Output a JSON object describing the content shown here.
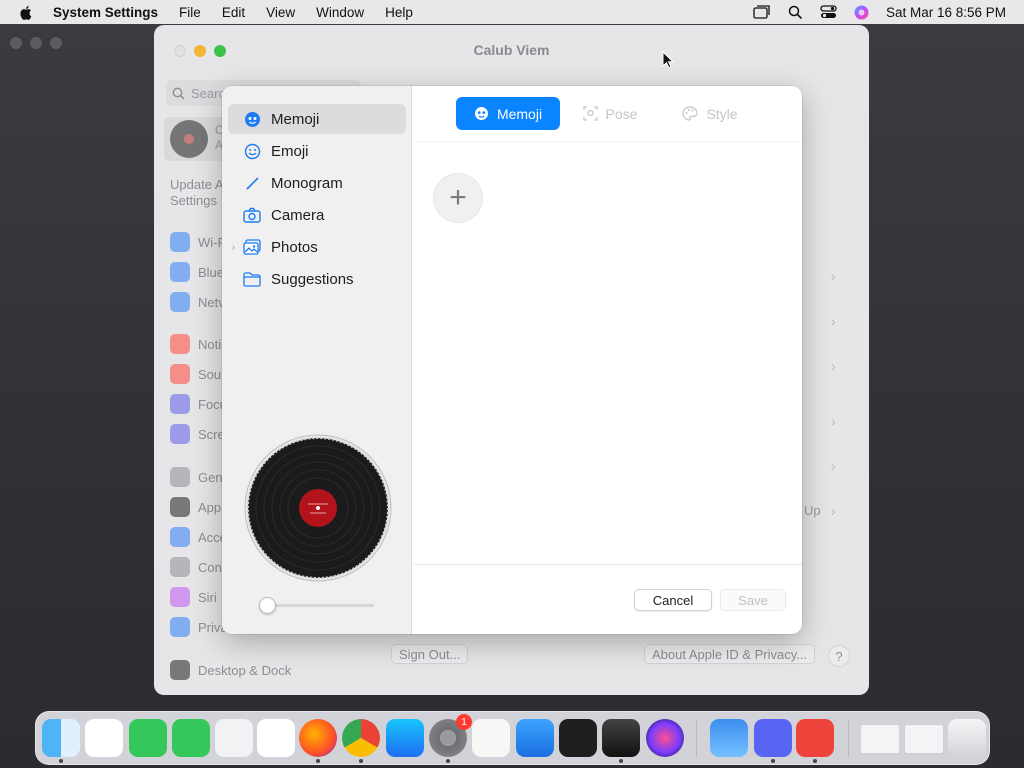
{
  "menubar": {
    "app_name": "System Settings",
    "menus": [
      "File",
      "Edit",
      "View",
      "Window",
      "Help"
    ],
    "clock": "Sat Mar 16  8:56 PM"
  },
  "settings_window": {
    "title": "Calub Viem",
    "search_placeholder": "Search",
    "profile_lines": [
      "C",
      "A"
    ],
    "update_lines": [
      "Update A",
      "Settings"
    ],
    "sidebar": [
      {
        "label": "Wi-F",
        "icon": "wifi-icon",
        "color": "#2f7ff7"
      },
      {
        "label": "Blue",
        "icon": "bluetooth-icon",
        "color": "#2f7ff7"
      },
      {
        "label": "Netv",
        "icon": "network-icon",
        "color": "#2f7ff7"
      },
      {
        "label": "Noti",
        "icon": "notifications-icon",
        "color": "#ff453a"
      },
      {
        "label": "Sour",
        "icon": "sound-icon",
        "color": "#ff453a"
      },
      {
        "label": "Focu",
        "icon": "focus-icon",
        "color": "#5e5ce6"
      },
      {
        "label": "Scre",
        "icon": "screen-time-icon",
        "color": "#5e5ce6"
      },
      {
        "label": "Gen",
        "icon": "general-icon",
        "color": "#8e8e93"
      },
      {
        "label": "App",
        "icon": "appearance-icon",
        "color": "#1d1d1f"
      },
      {
        "label": "Acce",
        "icon": "accessibility-icon",
        "color": "#2f7ff7"
      },
      {
        "label": "Con",
        "icon": "control-center-icon",
        "color": "#8e8e93"
      },
      {
        "label": "Siri",
        "icon": "siri-icon",
        "color": "#bf5af2"
      },
      {
        "label": "Priva",
        "icon": "privacy-icon",
        "color": "#2f7ff7"
      },
      {
        "label": "Desktop & Dock",
        "icon": "desktop-dock-icon",
        "color": "#1d1d1f"
      }
    ],
    "up_text": "Up",
    "sign_out": "Sign Out...",
    "about": "About Apple ID & Privacy...",
    "help": "?"
  },
  "picker": {
    "sources": [
      {
        "label": "Memoji",
        "icon": "memoji-icon",
        "selected": true
      },
      {
        "label": "Emoji",
        "icon": "emoji-icon"
      },
      {
        "label": "Monogram",
        "icon": "monogram-icon"
      },
      {
        "label": "Camera",
        "icon": "camera-icon"
      },
      {
        "label": "Photos",
        "icon": "photos-icon",
        "disclosure": true
      },
      {
        "label": "Suggestions",
        "icon": "folder-icon"
      }
    ],
    "tabs": [
      {
        "label": "Memoji",
        "state": "active"
      },
      {
        "label": "Pose",
        "state": "disabled"
      },
      {
        "label": "Style",
        "state": "disabled"
      }
    ],
    "add_label": "+",
    "zoom_level": 0,
    "cancel": "Cancel",
    "save": "Save",
    "accent": "#0a84ff"
  },
  "dock": {
    "apps": [
      {
        "name": "finder-icon",
        "running": true
      },
      {
        "name": "vscode-icon",
        "running": false
      },
      {
        "name": "facetime-icon",
        "running": false
      },
      {
        "name": "messages-icon",
        "running": false
      },
      {
        "name": "launchpad-icon",
        "running": false
      },
      {
        "name": "safari-icon",
        "running": false
      },
      {
        "name": "firefox-icon",
        "running": true
      },
      {
        "name": "chrome-icon",
        "running": true
      },
      {
        "name": "app-store-icon",
        "running": false
      },
      {
        "name": "system-settings-icon",
        "running": true,
        "badge": "1"
      },
      {
        "name": "textedit-icon",
        "running": false
      },
      {
        "name": "keynote-icon",
        "running": false
      },
      {
        "name": "terminal-icon",
        "running": false
      },
      {
        "name": "garageband-icon",
        "running": true
      },
      {
        "name": "siri-icon",
        "running": false
      },
      {
        "name": "weather-icon",
        "running": false
      },
      {
        "name": "discord-icon",
        "running": true
      },
      {
        "name": "anydesk-icon",
        "running": true
      },
      {
        "name": "window-thumbnail-1",
        "running": false
      },
      {
        "name": "window-thumbnail-2",
        "running": false
      },
      {
        "name": "trash-icon",
        "running": false
      }
    ]
  }
}
